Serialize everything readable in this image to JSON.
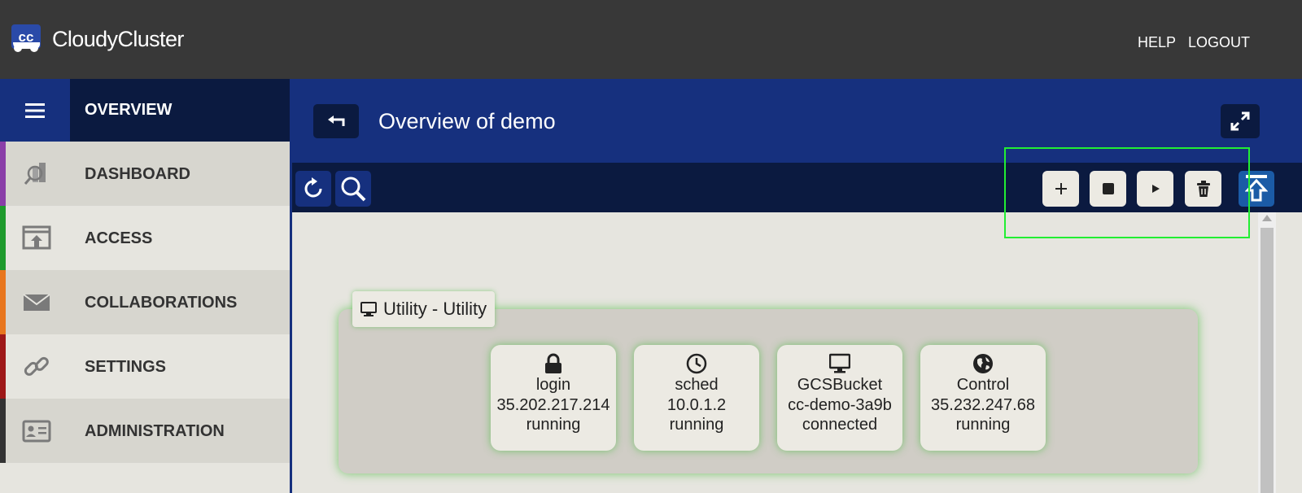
{
  "app": {
    "brand": "CloudyCluster",
    "logo_text": "cc"
  },
  "topnav": {
    "help": "HELP",
    "logout": "LOGOUT"
  },
  "sidebar": {
    "title": "OVERVIEW",
    "items": [
      {
        "label": "DASHBOARD",
        "icon": "dashboard-icon",
        "color": "#8a3ea8"
      },
      {
        "label": "ACCESS",
        "icon": "access-icon",
        "color": "#1e9a2c"
      },
      {
        "label": "COLLABORATIONS",
        "icon": "envelope-icon",
        "color": "#e8761e"
      },
      {
        "label": "SETTINGS",
        "icon": "link-icon",
        "color": "#9e1818"
      },
      {
        "label": "ADMINISTRATION",
        "icon": "id-card-icon",
        "color": "#333333"
      }
    ]
  },
  "main": {
    "title": "Overview of demo"
  },
  "toolbar": {
    "actions": [
      "add",
      "stop",
      "start",
      "delete"
    ]
  },
  "group": {
    "label": "Utility - Utility",
    "nodes": [
      {
        "icon": "lock-icon",
        "name": "login",
        "address": "35.202.217.214",
        "status": "running"
      },
      {
        "icon": "clock-icon",
        "name": "sched",
        "address": "10.0.1.2",
        "status": "running"
      },
      {
        "icon": "monitor-icon",
        "name": "GCSBucket",
        "address": "cc-demo-3a9b",
        "status": "connected"
      },
      {
        "icon": "globe-icon",
        "name": "Control",
        "address": "35.232.247.68",
        "status": "running"
      }
    ]
  },
  "colors": {
    "topbar": "#383838",
    "navy_dark": "#0b1a40",
    "navy": "#16307e",
    "highlight": "#22ee33",
    "node_glow": "#50be46"
  }
}
